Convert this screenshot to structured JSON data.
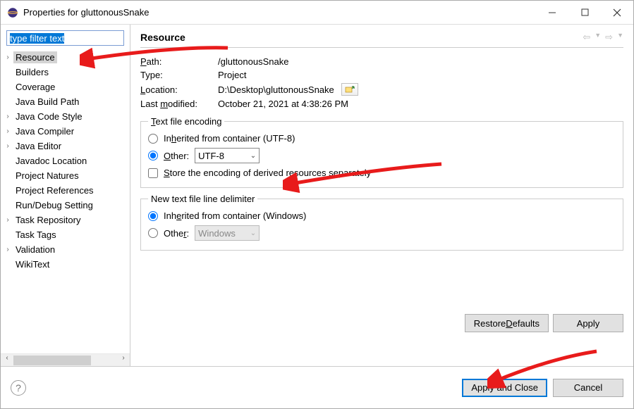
{
  "window": {
    "title": "Properties for gluttonousSnake"
  },
  "sidebar": {
    "filter_placeholder": "type filter text",
    "filter_value": "type filter text",
    "items": [
      {
        "label": "Resource",
        "expandable": true,
        "selected": true
      },
      {
        "label": "Builders"
      },
      {
        "label": "Coverage"
      },
      {
        "label": "Java Build Path"
      },
      {
        "label": "Java Code Style",
        "expandable": true
      },
      {
        "label": "Java Compiler",
        "expandable": true
      },
      {
        "label": "Java Editor",
        "expandable": true
      },
      {
        "label": "Javadoc Location"
      },
      {
        "label": "Project Natures"
      },
      {
        "label": "Project References"
      },
      {
        "label": "Run/Debug Setting"
      },
      {
        "label": "Task Repository",
        "expandable": true
      },
      {
        "label": "Task Tags"
      },
      {
        "label": "Validation",
        "expandable": true
      },
      {
        "label": "WikiText"
      }
    ]
  },
  "content": {
    "heading": "Resource",
    "path_label": "Path:",
    "path_value": "/gluttonousSnake",
    "type_label": "Type:",
    "type_value": "Project",
    "location_label": "Location:",
    "location_value": "D:\\Desktop\\gluttonousSnake",
    "modified_label": "Last modified:",
    "modified_value": "October 21, 2021 at 4:38:26 PM",
    "encoding_group_label": "Text file encoding",
    "encoding_inherited_label": "Inherited from container (UTF-8)",
    "encoding_other_label": "Other:",
    "encoding_other_value": "UTF-8",
    "encoding_store_label": "Store the encoding of derived resources separately",
    "delimiter_group_label": "New text file line delimiter",
    "delimiter_inherited_label": "Inherited from container (Windows)",
    "delimiter_other_label": "Other:",
    "delimiter_other_value": "Windows",
    "restore_defaults": "Restore Defaults",
    "apply": "Apply"
  },
  "footer": {
    "apply_close": "Apply and Close",
    "cancel": "Cancel"
  }
}
